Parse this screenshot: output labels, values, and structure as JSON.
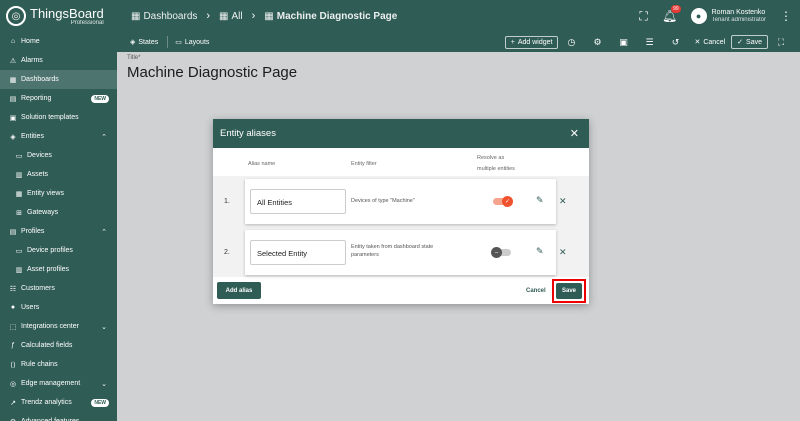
{
  "app": {
    "brand": "ThingsBoard",
    "edition": "Professional"
  },
  "breadcrumb": {
    "dashboards": "Dashboards",
    "all": "All",
    "current": "Machine Diagnostic Page"
  },
  "user": {
    "name": "Roman Kostenko",
    "role": "Tenant administrator",
    "notifications": "99"
  },
  "sidebar": {
    "items": [
      {
        "label": "Home",
        "icon": "home-icon",
        "glyph": "⌂"
      },
      {
        "label": "Alarms",
        "icon": "alarm-icon",
        "glyph": "⚠"
      },
      {
        "label": "Dashboards",
        "icon": "dashboard-icon",
        "glyph": "▦"
      },
      {
        "label": "Reporting",
        "icon": "report-icon",
        "glyph": "▤",
        "badge": "NEW"
      },
      {
        "label": "Solution templates",
        "icon": "template-icon",
        "glyph": "▣"
      },
      {
        "label": "Entities",
        "icon": "entities-icon",
        "glyph": "◈",
        "chevron": "⌃"
      },
      {
        "label": "Devices",
        "icon": "device-icon",
        "glyph": "▭",
        "sub": true
      },
      {
        "label": "Assets",
        "icon": "asset-icon",
        "glyph": "▥",
        "sub": true
      },
      {
        "label": "Entity views",
        "icon": "entity-view-icon",
        "glyph": "▦",
        "sub": true
      },
      {
        "label": "Gateways",
        "icon": "gateway-icon",
        "glyph": "⊞",
        "sub": true
      },
      {
        "label": "Profiles",
        "icon": "profiles-icon",
        "glyph": "▤",
        "chevron": "⌃"
      },
      {
        "label": "Device profiles",
        "icon": "device-profile-icon",
        "glyph": "▭",
        "sub": true
      },
      {
        "label": "Asset profiles",
        "icon": "asset-profile-icon",
        "glyph": "▥",
        "sub": true
      },
      {
        "label": "Customers",
        "icon": "customers-icon",
        "glyph": "☷"
      },
      {
        "label": "Users",
        "icon": "users-icon",
        "glyph": "●"
      },
      {
        "label": "Integrations center",
        "icon": "integrations-icon",
        "glyph": "⬚",
        "chevron": "⌄"
      },
      {
        "label": "Calculated fields",
        "icon": "function-icon",
        "glyph": "ƒ"
      },
      {
        "label": "Rule chains",
        "icon": "rule-chain-icon",
        "glyph": "⟨⟩"
      },
      {
        "label": "Edge management",
        "icon": "edge-icon",
        "glyph": "◎",
        "chevron": "⌄"
      },
      {
        "label": "Trendz analytics",
        "icon": "trendz-icon",
        "glyph": "↗",
        "badge": "NEW"
      },
      {
        "label": "Advanced features",
        "icon": "advanced-icon",
        "glyph": "⚙",
        "chevron": "⌄"
      }
    ]
  },
  "toolbar": {
    "states": "States",
    "layouts": "Layouts",
    "add_widget": "Add widget",
    "cancel": "Cancel",
    "save": "Save"
  },
  "page": {
    "title_caption": "Title*",
    "title": "Machine Diagnostic Page"
  },
  "dialog": {
    "title": "Entity aliases",
    "columns": {
      "alias_name": "Alias name",
      "entity_filter": "Entity filter",
      "resolve_line1": "Resolve as",
      "resolve_line2": "multiple entities"
    },
    "rows": [
      {
        "num": "1.",
        "alias": "All Entities",
        "filter_line1": "Devices of type \"Machine\"",
        "filter_line2": "",
        "resolve_multiple": true
      },
      {
        "num": "2.",
        "alias": "Selected Entity",
        "filter_line1": "Entity taken from dashboard state",
        "filter_line2": "parameters",
        "resolve_multiple": false
      }
    ],
    "add_alias": "Add alias",
    "cancel": "Cancel",
    "save": "Save"
  },
  "colors": {
    "primary": "#305c56",
    "toggle_on": "#f0522e",
    "highlight": "#ee0000"
  }
}
